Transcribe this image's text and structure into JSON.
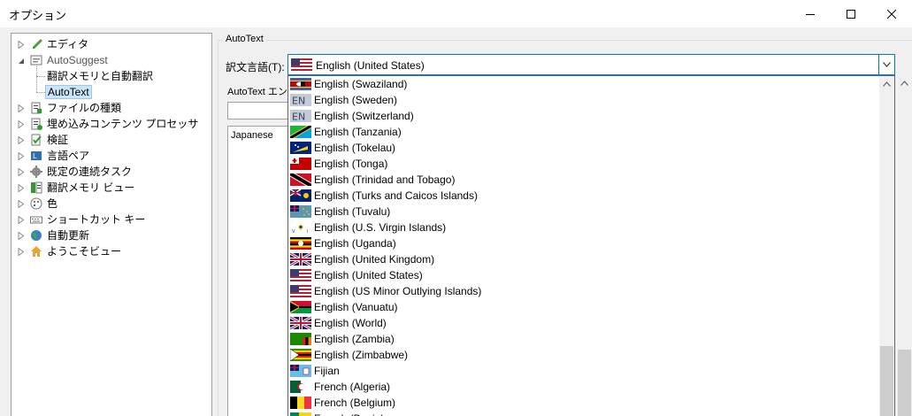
{
  "window": {
    "title": "オプション",
    "minimize_icon": "minimize-icon",
    "maximize_icon": "maximize-icon",
    "close_icon": "close-icon"
  },
  "tree": {
    "items": [
      {
        "label": "エディタ",
        "icon": "pencil-icon",
        "expander": "collapsed"
      },
      {
        "label": "AutoSuggest",
        "icon": "autosuggest-icon",
        "expander": "expanded",
        "gray": true
      },
      {
        "label": "翻訳メモリと自動翻訳",
        "icon": "",
        "expander": "none",
        "child": true
      },
      {
        "label": "AutoText",
        "icon": "",
        "expander": "none",
        "child": true,
        "selected": true
      },
      {
        "label": "ファイルの種類",
        "icon": "file-types-icon",
        "expander": "collapsed"
      },
      {
        "label": "埋め込みコンテンツ プロセッサ",
        "icon": "embedded-processor-icon",
        "expander": "collapsed"
      },
      {
        "label": "検証",
        "icon": "verification-icon",
        "expander": "collapsed"
      },
      {
        "label": "言語ペア",
        "icon": "language-pair-icon",
        "expander": "collapsed"
      },
      {
        "label": "既定の連続タスク",
        "icon": "gear-icon",
        "expander": "collapsed"
      },
      {
        "label": "翻訳メモリ ビュー",
        "icon": "tm-view-icon",
        "expander": "collapsed"
      },
      {
        "label": "色",
        "icon": "palette-icon",
        "expander": "collapsed"
      },
      {
        "label": "ショートカット キー",
        "icon": "keyboard-icon",
        "expander": "collapsed"
      },
      {
        "label": "自動更新",
        "icon": "globe-icon",
        "expander": "collapsed"
      },
      {
        "label": "ようこそビュー",
        "icon": "home-icon",
        "expander": "collapsed"
      }
    ]
  },
  "autotext": {
    "group_title": "AutoText",
    "target_language_label": "訳文言語(T):",
    "target_language_value": "English (United States)",
    "autotext_entries_label": "AutoText エントリ",
    "entry_input_value": "",
    "list_items": [
      "Japanese"
    ]
  },
  "dropdown": {
    "items": [
      {
        "label": "English (Swaziland)",
        "flag": "swaziland-flag"
      },
      {
        "label": "English (Sweden)",
        "flag": "en-code-flag",
        "code": "EN"
      },
      {
        "label": "English (Switzerland)",
        "flag": "en-code-flag",
        "code": "EN"
      },
      {
        "label": "English (Tanzania)",
        "flag": "tanzania-flag"
      },
      {
        "label": "English (Tokelau)",
        "flag": "tokelau-flag"
      },
      {
        "label": "English (Tonga)",
        "flag": "tonga-flag"
      },
      {
        "label": "English (Trinidad and Tobago)",
        "flag": "trinidad-flag"
      },
      {
        "label": "English (Turks and Caicos Islands)",
        "flag": "turks-caicos-flag"
      },
      {
        "label": "English (Tuvalu)",
        "flag": "tuvalu-flag"
      },
      {
        "label": "English (U.S. Virgin Islands)",
        "flag": "usvi-flag"
      },
      {
        "label": "English (Uganda)",
        "flag": "uganda-flag"
      },
      {
        "label": "English (United Kingdom)",
        "flag": "uk-flag"
      },
      {
        "label": "English (United States)",
        "flag": "us-flag"
      },
      {
        "label": "English (US Minor Outlying Islands)",
        "flag": "us-flag"
      },
      {
        "label": "English (Vanuatu)",
        "flag": "vanuatu-flag"
      },
      {
        "label": "English (World)",
        "flag": "uk-flag"
      },
      {
        "label": "English (Zambia)",
        "flag": "zambia-flag"
      },
      {
        "label": "English (Zimbabwe)",
        "flag": "zimbabwe-flag"
      },
      {
        "label": "Fijian",
        "flag": "fiji-flag"
      },
      {
        "label": "French (Algeria)",
        "flag": "algeria-flag"
      },
      {
        "label": "French (Belgium)",
        "flag": "belgium-flag"
      },
      {
        "label": "French (Benin)",
        "flag": "benin-flag"
      }
    ]
  },
  "colors": {
    "accent": "#0078d7",
    "selection": "#cce4f7"
  }
}
